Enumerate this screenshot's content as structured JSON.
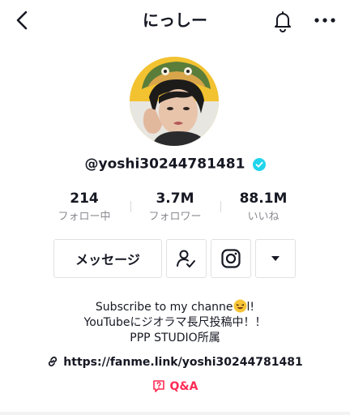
{
  "header": {
    "title": "にっしー",
    "back_icon": "chevron-left-icon",
    "bell_icon": "bell-icon",
    "more_icon": "more-horizontal-icon"
  },
  "profile": {
    "username": "@yoshi30244781481",
    "verified": true,
    "verified_color": "#20d5ec"
  },
  "stats": [
    {
      "value": "214",
      "label": "フォロー中"
    },
    {
      "value": "3.7M",
      "label": "フォロワー"
    },
    {
      "value": "88.1M",
      "label": "いいね"
    }
  ],
  "actions": {
    "message_label": "メッセージ",
    "follow_icon": "user-check-icon",
    "instagram_icon": "instagram-icon",
    "dropdown_icon": "caret-down-icon"
  },
  "bio": {
    "line1_before": "Subscribe to my channe",
    "line1_after": "l!",
    "line2": "YouTubeにジオラマ長尺投稿中！！",
    "line3": "PPP STUDIO所属"
  },
  "link": {
    "url": "https://fanme.link/yoshi30244781481",
    "icon": "link-icon"
  },
  "qa": {
    "label": "Q&A",
    "color": "#fe2c55",
    "icon": "question-bubble-icon"
  }
}
